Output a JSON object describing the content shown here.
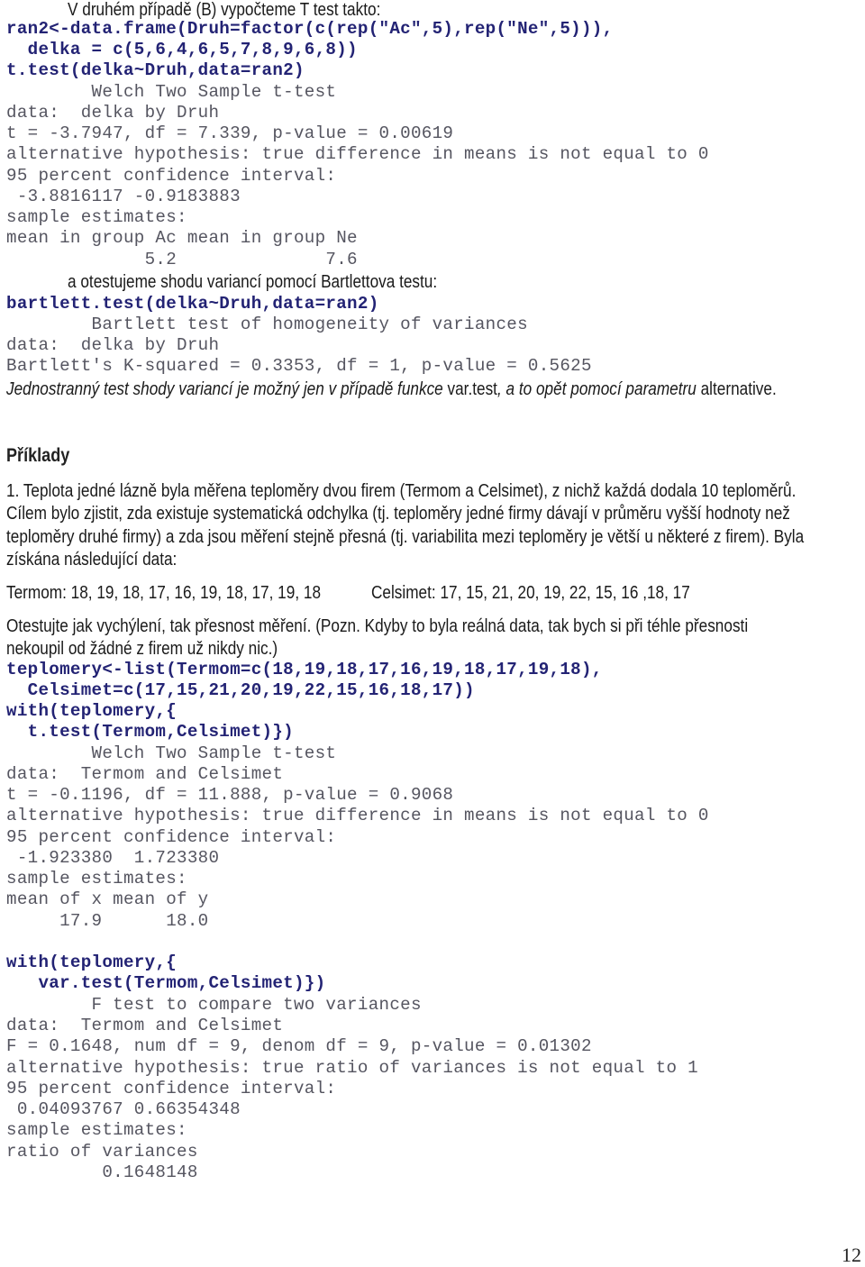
{
  "section1": {
    "intro": "V druhém případě (B) vypočteme T test takto:",
    "code": [
      "ran2<-data.frame(Druh=factor(c(rep(\"Ac\",5),rep(\"Ne\",5))),",
      "  delka = c(5,6,4,6,5,7,8,9,6,8))",
      "t.test(delka~Druh,data=ran2)"
    ],
    "output": [
      "        Welch Two Sample t-test",
      "data:  delka by Druh",
      "t = -3.7947, df = 7.339, p-value = 0.00619",
      "alternative hypothesis: true difference in means is not equal to 0",
      "95 percent confidence interval:",
      " -3.8816117 -0.9183883",
      "sample estimates:",
      "mean in group Ac mean in group Ne",
      "             5.2              7.6"
    ]
  },
  "section2": {
    "intro": "a otestujeme shodu variancí pomocí Bartlettova testu:",
    "code": [
      "bartlett.test(delka~Druh,data=ran2)"
    ],
    "output": [
      "        Bartlett test of homogeneity of variances",
      "data:  delka by Druh",
      "Bartlett's K-squared = 0.3353, df = 1, p-value = 0.5625"
    ],
    "note_parts": [
      {
        "text": "Jednostranný test shody variancí je možný jen v případě funkce ",
        "italic": true
      },
      {
        "text": "var.test",
        "italic": false
      },
      {
        "text": ", a to opět pomocí parametru ",
        "italic": true
      },
      {
        "text": "alternative.",
        "italic": false
      }
    ]
  },
  "examples": {
    "heading": "Příklady",
    "task_lines": [
      "1. Teplota jedné lázně byla měřena teploměry dvou firem (Termom a Celsimet), z nichž každá dodala 10 teploměrů.",
      "Cílem bylo zjistit, zda existuje systematická odchylka (tj. teploměry jedné firmy dávají v průměru vyšší hodnoty než",
      "teploměry druhé firmy) a zda jsou měření stejně přesná (tj. variabilita mezi teploměry je větší u některé z firem). Byla",
      "získána následující data:"
    ],
    "data_termom": "Termom: 18, 19, 18, 17, 16, 19, 18, 17, 19, 18",
    "data_celsimet": "Celsimet: 17, 15, 21, 20, 19, 22, 15, 16 ,18, 17",
    "instruction_lines": [
      "Otestujte jak vychýlení, tak přesnost měření. (Pozn. Kdyby to byla reálná data, tak bych si při téhle přesnosti",
      "nekoupil od žádné z firem už nikdy nic.)"
    ],
    "code1": [
      "teplomery<-list(Termom=c(18,19,18,17,16,19,18,17,19,18),",
      "  Celsimet=c(17,15,21,20,19,22,15,16,18,17))",
      "with(teplomery,{",
      "  t.test(Termom,Celsimet)})"
    ],
    "output1": [
      "        Welch Two Sample t-test",
      "data:  Termom and Celsimet",
      "t = -0.1196, df = 11.888, p-value = 0.9068",
      "alternative hypothesis: true difference in means is not equal to 0",
      "95 percent confidence interval:",
      " -1.923380  1.723380",
      "sample estimates:",
      "mean of x mean of y",
      "     17.9      18.0"
    ],
    "code2": [
      "with(teplomery,{",
      "   var.test(Termom,Celsimet)})"
    ],
    "output2": [
      "        F test to compare two variances",
      "data:  Termom and Celsimet",
      "F = 0.1648, num df = 9, denom df = 9, p-value = 0.01302",
      "alternative hypothesis: true ratio of variances is not equal to 1",
      "95 percent confidence interval:",
      " 0.04093767 0.66354348",
      "sample estimates:",
      "ratio of variances",
      "         0.1648148"
    ]
  },
  "page_number": "12"
}
